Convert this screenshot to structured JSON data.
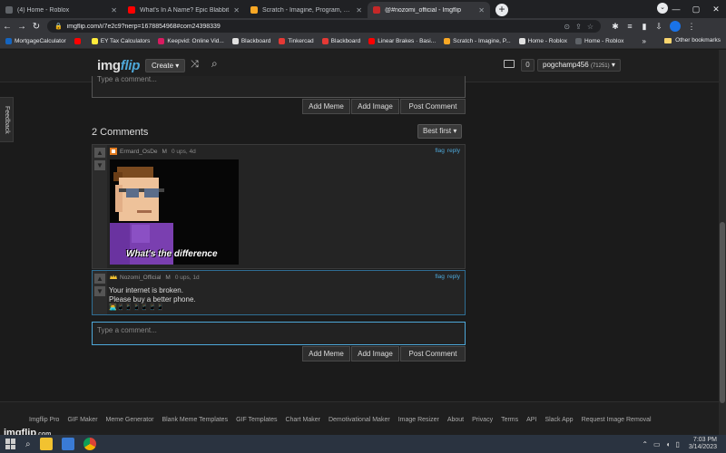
{
  "browser": {
    "tabs": [
      {
        "title": "(4) Home - Roblox",
        "color": "#5f6368",
        "active": false
      },
      {
        "title": "What's In A Name? Epic Blabbit",
        "color": "#ff0000",
        "active": false
      },
      {
        "title": "Scratch - Imagine, Program, Sha",
        "color": "#f9a825",
        "active": false
      },
      {
        "title": "@#nozomi_official - Imgflip",
        "color": "#c62828",
        "active": true
      }
    ],
    "url": "imgflip.com/i/7e2c9?nerp=1678854968#com24398339",
    "bookmarks": [
      {
        "label": "MortgageCalculator",
        "color": "#1565c0"
      },
      {
        "label": "",
        "color": "#ff0000"
      },
      {
        "label": "EY Tax Calculators",
        "color": "#ffeb3b"
      },
      {
        "label": "Keepvid: Online Vid...",
        "color": "#d81b60"
      },
      {
        "label": "Blackboard",
        "color": "#e0e0e0"
      },
      {
        "label": "Tinkercad",
        "color": "#e53935"
      },
      {
        "label": "Blackboard",
        "color": "#e53935"
      },
      {
        "label": "Linear Brakes · Basi...",
        "color": "#ff0000"
      },
      {
        "label": "Scratch - Imagine, P...",
        "color": "#f9a825"
      },
      {
        "label": "Home - Roblox",
        "color": "#e0e0e0"
      },
      {
        "label": "Home - Roblox",
        "color": "#5f6368"
      }
    ],
    "other_bookmarks": "Other bookmarks"
  },
  "header": {
    "logo_a": "img",
    "logo_b": "flip",
    "create_label": "Create ▾",
    "notif_count": "0",
    "username": "pogchamp456",
    "points": "(71251)",
    "user_caret": "▾"
  },
  "feedback_label": "Feedback",
  "top_box": {
    "placeholder": "Type a comment..."
  },
  "buttons": {
    "add_meme": "Add Meme",
    "add_image": "Add Image",
    "post_comment": "Post Comment"
  },
  "comments": {
    "title": "2 Comments",
    "sort_label": "Best first ▾",
    "items": [
      {
        "author": "Ermard_OsDe",
        "gender": "M",
        "meta": "0 ups, 4d",
        "flag": "flag",
        "reply": "reply",
        "meme_caption": "What's the difference"
      },
      {
        "author": "Nozomi_Official",
        "gender": "M",
        "meta": "0 ups, 1d",
        "flag": "flag",
        "reply": "reply",
        "line1": "Your internet is broken.",
        "line2": "Please buy a better phone.",
        "line3": "👨‍💻📱📱📱📱📱📱"
      }
    ]
  },
  "bottom_box": {
    "placeholder": "Type a comment..."
  },
  "footer": {
    "links": [
      "Imgflip Pro",
      "GIF Maker",
      "Meme Generator",
      "Blank Meme Templates",
      "GIF Templates",
      "Chart Maker",
      "Demotivational Maker",
      "Image Resizer",
      "About",
      "Privacy",
      "Terms",
      "API",
      "Slack App",
      "Request Image Removal"
    ],
    "watermark_a": "imgflip",
    "watermark_b": ".com"
  },
  "taskbar": {
    "time": "7:03 PM",
    "date": "3/14/2023"
  }
}
